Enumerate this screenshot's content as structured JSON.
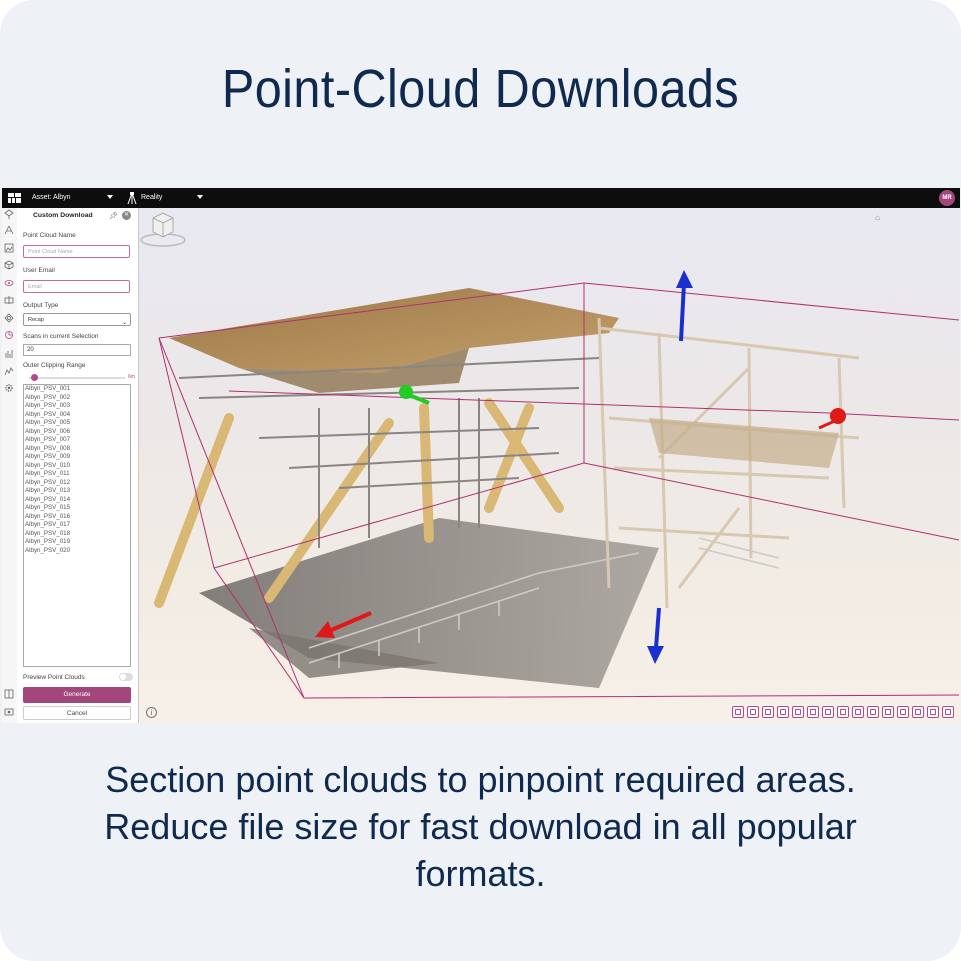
{
  "headline": "Point-Cloud Downloads",
  "caption": {
    "line1": "Section point clouds to pinpoint required areas.",
    "line2": "Reduce file size for fast download in all popular",
    "line3": "formats."
  },
  "topbar": {
    "asset_label": "Asset: Albyn",
    "reality_label": "Reality",
    "avatar_initials": "MR"
  },
  "panel": {
    "title": "Custom Download",
    "pin_icon": "pin-icon",
    "close_icon": "close-icon",
    "name_label": "Point Cloud Name",
    "name_placeholder": "Point Cloud Name",
    "email_label": "User Email",
    "email_placeholder": "Email",
    "output_label": "Output Type",
    "output_value": "Recap",
    "scans_label": "Scans in current Selection",
    "scans_value": "20",
    "clip_label": "Outer Clipping Range",
    "clip_value_label": "6m",
    "scans": [
      "Albyn_PSV_001",
      "Albyn_PSV_002",
      "Albyn_PSV_003",
      "Albyn_PSV_004",
      "Albyn_PSV_005",
      "Albyn_PSV_006",
      "Albyn_PSV_007",
      "Albyn_PSV_008",
      "Albyn_PSV_009",
      "Albyn_PSV_010",
      "Albyn_PSV_011",
      "Albyn_PSV_012",
      "Albyn_PSV_013",
      "Albyn_PSV_014",
      "Albyn_PSV_015",
      "Albyn_PSV_016",
      "Albyn_PSV_017",
      "Albyn_PSV_018",
      "Albyn_PSV_019",
      "Albyn_PSV_020"
    ],
    "preview_label": "Preview Point Clouds",
    "generate_label": "Generate",
    "cancel_label": "Cancel"
  },
  "colors": {
    "accent": "#a3467c",
    "navy": "#0f2a4e",
    "gizmo_red": "#e01818",
    "gizmo_green": "#22cc22",
    "gizmo_blue": "#1a2fd0",
    "clip_box": "#b0306e"
  },
  "icons": {
    "rail": [
      "layers-icon",
      "measure-icon",
      "image-icon",
      "cube-icon",
      "eye-icon",
      "section-icon",
      "settings-icon",
      "chart-icon",
      "chart-icon",
      "gear-icon"
    ],
    "toolbar": [
      "pin-icon",
      "map-pin-icon",
      "location-icon",
      "pencil-icon",
      "tag-icon",
      "clipboard-icon",
      "scissors-icon",
      "cut-icon",
      "crop-icon",
      "layers-icon",
      "cursor-icon",
      "chart-icon",
      "gear-icon",
      "home-icon",
      "box-icon"
    ]
  }
}
